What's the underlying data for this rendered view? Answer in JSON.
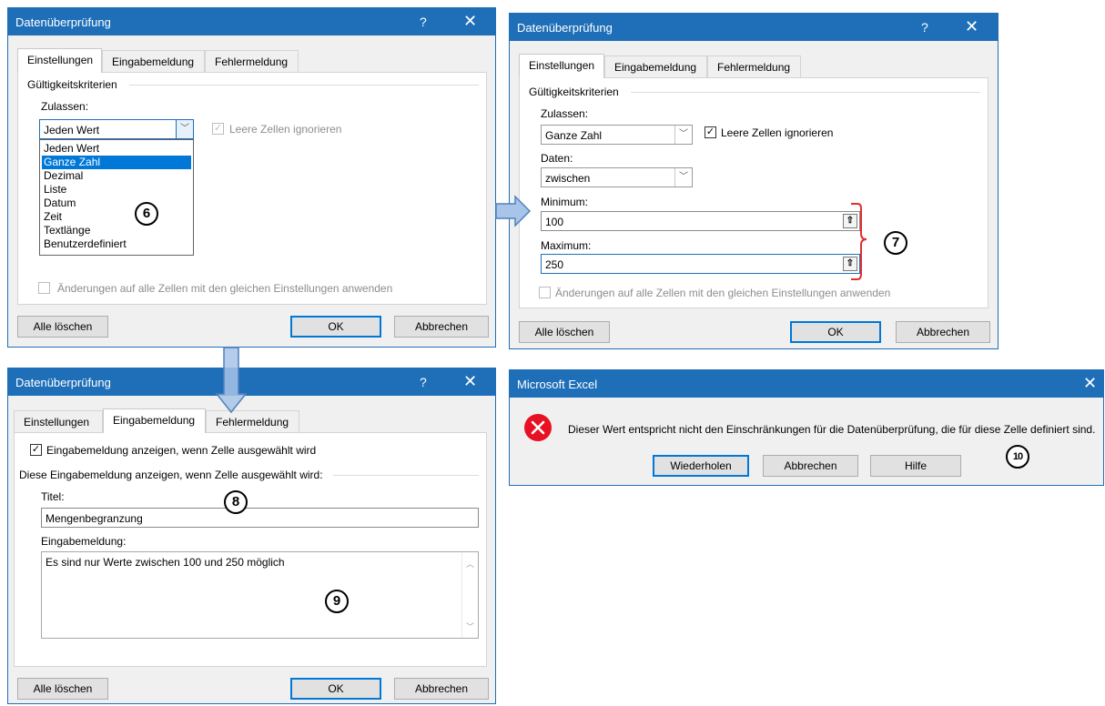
{
  "dialog_title": "Datenüberprüfung",
  "help_glyph": "?",
  "close_glyph": "✕",
  "tabs": [
    "Einstellungen",
    "Eingabemeldung",
    "Fehlermeldung"
  ],
  "criteria_label": "Gültigkeitskriterien",
  "allow_label": "Zulassen:",
  "ignore_blank_label": "Leere Zellen ignorieren",
  "apply_all_label": "Änderungen auf alle Zellen mit den gleichen Einstellungen anwenden",
  "clear_all_button": "Alle löschen",
  "ok_button": "OK",
  "cancel_button": "Abbrechen",
  "d1": {
    "allow_value": "Jeden Wert",
    "dropdown_options": [
      "Jeden Wert",
      "Ganze Zahl",
      "Dezimal",
      "Liste",
      "Datum",
      "Zeit",
      "Textlänge",
      "Benutzerdefiniert"
    ],
    "selected_option": "Ganze Zahl",
    "marker": "6"
  },
  "d2": {
    "allow_value": "Ganze Zahl",
    "data_label": "Daten:",
    "data_value": "zwischen",
    "min_label": "Minimum:",
    "min_value": "100",
    "max_label": "Maximum:",
    "max_value": "250",
    "marker": "7"
  },
  "d3": {
    "show_checkbox_label": "Eingabemeldung anzeigen, wenn Zelle ausgewählt wird",
    "group_label": "Diese Eingabemeldung anzeigen, wenn Zelle ausgewählt wird:",
    "title_label": "Titel:",
    "title_value": "Mengenbegranzung",
    "message_label": "Eingabemeldung:",
    "message_value": "Es sind nur Werte zwischen 100 und 250 möglich",
    "marker_title": "8",
    "marker_message": "9"
  },
  "d4": {
    "title": "Microsoft Excel",
    "message": "Dieser Wert entspricht nicht den Einschränkungen für die Datenüberprüfung, die für diese Zelle definiert sind.",
    "retry_button": "Wiederholen",
    "cancel_button": "Abbrechen",
    "help_button": "Hilfe",
    "marker": "10"
  },
  "colors": {
    "titlebar": "#1f6fb8",
    "dialog_bg": "#f0f0f0",
    "selection": "#0078d7",
    "bracket": "#e03030",
    "error_icon": "#e81123",
    "arrow": "#7aa6d8"
  }
}
